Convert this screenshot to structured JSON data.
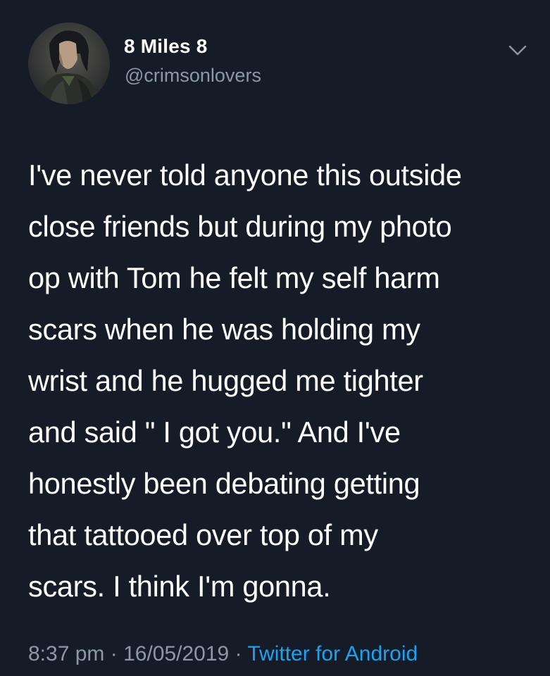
{
  "tweet": {
    "display_name": "8 Miles 8",
    "handle": "@crimsonlovers",
    "lines": [
      "I've never told anyone this outside",
      "close friends but during my photo",
      "op with Tom he felt my self harm",
      "scars when he was holding my",
      "wrist and he hugged me tighter",
      "and said \" I got you.\" And I've",
      "honestly been debating getting",
      "that tattooed over top of my",
      "scars. I think I'm gonna."
    ],
    "time": "8:37 pm",
    "separator": "·",
    "date": "16/05/2019",
    "source": "Twitter for Android"
  },
  "icons": {
    "menu": "chevron-down-icon",
    "avatar": "avatar-photo"
  },
  "colors": {
    "background": "#151c27",
    "text": "#ffffff",
    "secondary": "#8b98a5",
    "link": "#1da1f2"
  }
}
